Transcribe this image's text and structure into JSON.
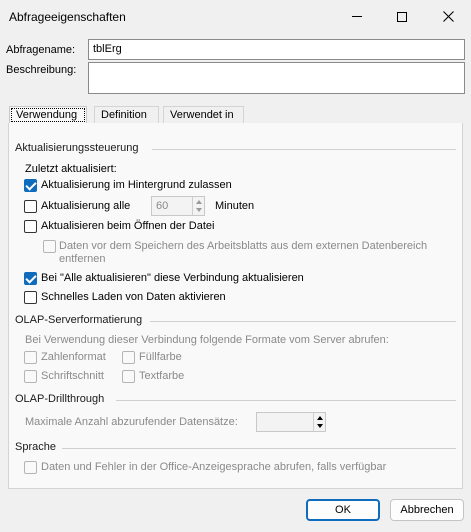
{
  "window": {
    "title": "Abfrageeigenschaften"
  },
  "fields": {
    "name_label": "Abfragename:",
    "name_value": "tblErg",
    "description_label": "Beschreibung:",
    "description_value": ""
  },
  "tabs": [
    {
      "label": "Verwendung",
      "active": true
    },
    {
      "label": "Definition",
      "active": false
    },
    {
      "label": "Verwendet in",
      "active": false
    }
  ],
  "refresh_control": {
    "title": "Aktualisierungssteuerung",
    "last_refreshed_label": "Zuletzt aktualisiert:",
    "background_refresh": {
      "label": "Aktualisierung im Hintergrund zulassen",
      "checked": true
    },
    "refresh_every": {
      "label": "Aktualisierung alle",
      "checked": false,
      "value": "60",
      "unit": "Minuten"
    },
    "refresh_on_open": {
      "label": "Aktualisieren beim Öffnen der Datei",
      "checked": false
    },
    "remove_data": {
      "label_line1": "Daten vor dem Speichern des Arbeitsblatts aus dem externen Datenbereich",
      "label_line2": "entfernen",
      "checked": false
    },
    "refresh_all": {
      "label": "Bei \"Alle aktualisieren\" diese Verbindung aktualisieren",
      "checked": true
    },
    "fast_load": {
      "label": "Schnelles Laden von Daten aktivieren",
      "checked": false
    }
  },
  "olap_formatting": {
    "title": "OLAP-Serverformatierung",
    "description": "Bei Verwendung dieser Verbindung folgende Formate vom Server abrufen:",
    "number_format": "Zahlenformat",
    "fill_color": "Füllfarbe",
    "font_style": "Schriftschnitt",
    "text_color": "Textfarbe"
  },
  "olap_drill": {
    "title": "OLAP-Drillthrough",
    "max_records_label": "Maximale Anzahl abzurufender Datensätze:",
    "max_records_value": ""
  },
  "language": {
    "title": "Sprache",
    "option_label": "Daten und Fehler in der Office-Anzeigesprache abrufen, falls verfügbar"
  },
  "buttons": {
    "ok": "OK",
    "cancel": "Abbrechen"
  }
}
